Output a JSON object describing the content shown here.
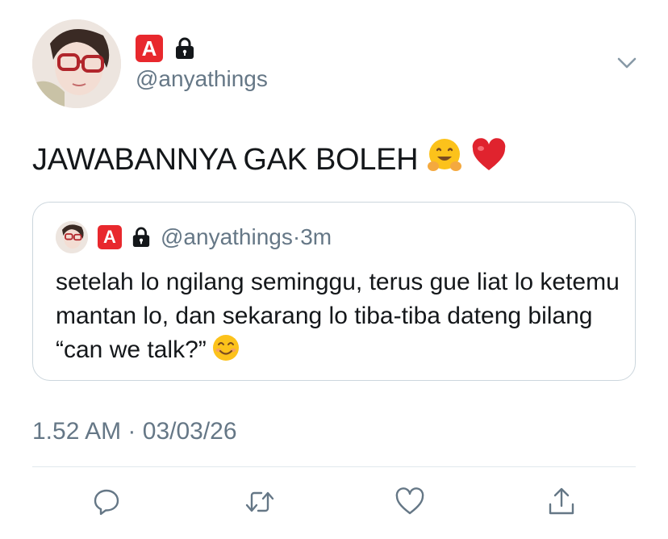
{
  "author": {
    "badge_letter": "A",
    "handle": "@anyathings",
    "avatar_desc": "profile-photo"
  },
  "tweet": {
    "text": "JAWABANNYA GAK BOLEH",
    "emojis": [
      "hugging-face",
      "red-heart"
    ]
  },
  "quoted": {
    "badge_letter": "A",
    "handle": "@anyathings",
    "separator": "·",
    "time": "3m",
    "text": "setelah lo ngilang seminggu, terus gue liat lo ketemu mantan lo, dan sekarang lo tiba-tiba dateng bilang “can we talk?”",
    "emoji": "smiling-face"
  },
  "meta": {
    "time": "1.52 AM",
    "separator": "·",
    "date": "03/03/26"
  },
  "actions": [
    "reply-icon",
    "retweet-icon",
    "like-icon",
    "share-icon"
  ],
  "colors": {
    "badge_red": "#e8282d",
    "secondary_text": "#657786",
    "border": "#ccd6dd",
    "icon": "#657786"
  }
}
